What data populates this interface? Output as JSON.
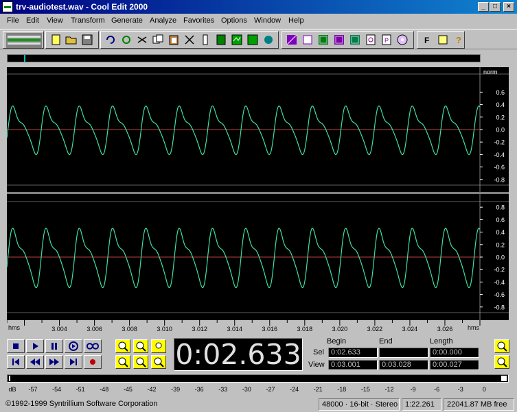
{
  "window": {
    "title": "trv-audiotest.wav - Cool Edit 2000",
    "buttons": {
      "minimize": "_",
      "maximize": "□",
      "close": "×"
    }
  },
  "menu": [
    "File",
    "Edit",
    "View",
    "Transform",
    "Generate",
    "Analyze",
    "Favorites",
    "Options",
    "Window",
    "Help"
  ],
  "toolbar": {
    "icons": [
      "multitrack-toggle-icon",
      "new-file-icon",
      "open-file-icon",
      "save-file-icon",
      "undo-icon",
      "repeat-last-icon",
      "cut-icon",
      "copy-icon",
      "paste-icon",
      "mix-paste-icon",
      "scissors-icon",
      "clipboard-icon",
      "trim-icon",
      "play-icon",
      "record-icon",
      "loop-icon",
      "spectral-icon",
      "settings-icon",
      "grid-icon",
      "multiselect-icon",
      "frequency-icon",
      "cue-list-icon",
      "play-list-icon",
      "cd-icon",
      "wave-info-icon",
      "help-icon"
    ]
  },
  "waveform": {
    "scale_label": "norm",
    "amplitude_ticks": [
      "0.6",
      "0.4",
      "0.2",
      "0.0",
      "-0.2",
      "-0.4",
      "-0.6",
      "-0.8"
    ],
    "channel2_ticks": [
      "0.8",
      "0.6",
      "0.4",
      "0.2",
      "0.0",
      "-0.2",
      "-0.4",
      "-0.6",
      "-0.8"
    ],
    "time_unit_left": "hms",
    "time_unit_right": "hms",
    "time_ticks": [
      "3.004",
      "3.006",
      "3.008",
      "3.010",
      "3.012",
      "3.014",
      "3.016",
      "3.018",
      "3.020",
      "3.022",
      "3.024",
      "3.026"
    ],
    "wave_color": "#40e0a0",
    "centerline_color": "#c04040"
  },
  "transport": {
    "icons": [
      "stop-icon",
      "play-icon",
      "pause-icon",
      "play-to-end-icon",
      "loop-play-icon",
      "go-to-start-icon",
      "rewind-icon",
      "fast-forward-icon",
      "go-to-end-icon",
      "record-icon"
    ]
  },
  "zoom": {
    "icons": [
      "zoom-in-icon",
      "zoom-out-icon",
      "zoom-full-icon",
      "zoom-selection-icon",
      "zoom-left-icon",
      "zoom-right-icon"
    ]
  },
  "time_display": "0:02.633",
  "selection": {
    "headers": {
      "begin": "Begin",
      "end": "End",
      "length": "Length"
    },
    "sel_label": "Sel",
    "view_label": "View",
    "sel_begin": "0:02.633",
    "sel_end": "",
    "sel_length": "0:00.000",
    "view_begin": "0:03.001",
    "view_end": "0:03.028",
    "view_length": "0:00.027"
  },
  "level_scale": [
    "dB",
    "-57",
    "-54",
    "-51",
    "-48",
    "-45",
    "-42",
    "-39",
    "-36",
    "-33",
    "-30",
    "-27",
    "-24",
    "-21",
    "-18",
    "-15",
    "-12",
    "-9",
    "-6",
    "-3",
    "0"
  ],
  "status": {
    "copyright": "©1992-1999 Syntrillium Software Corporation",
    "format": "48000 · 16-bit · Stereo",
    "duration": "1:22.261",
    "free_space": "22041.87 MB free"
  }
}
